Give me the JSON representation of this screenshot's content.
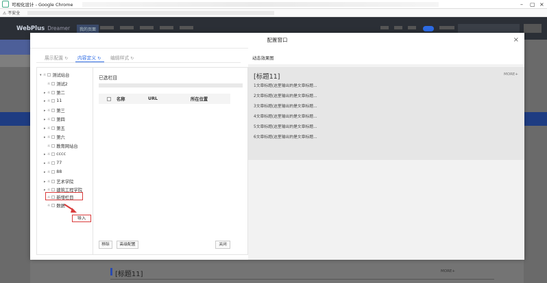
{
  "browser": {
    "title": "可视化设计 - Google Chrome",
    "security": "不安全"
  },
  "app": {
    "brand": "WebPlus",
    "brand_sub": "Dreamer",
    "nav_active": "我的页面"
  },
  "background": {
    "heading": "[标题11]",
    "more": "MORE+"
  },
  "modal": {
    "title": "配置窗口",
    "tabs": [
      {
        "label": "展示配置",
        "active": false
      },
      {
        "label": "内容定义",
        "active": true
      },
      {
        "label": "编辑样式",
        "active": false
      }
    ],
    "tree": [
      {
        "label": "测试站台",
        "level": 0,
        "expanded": true
      },
      {
        "label": "测试2",
        "level": 1,
        "leaf": true
      },
      {
        "label": "第二",
        "level": 1
      },
      {
        "label": "11",
        "level": 1
      },
      {
        "label": "第三",
        "level": 1
      },
      {
        "label": "第四",
        "level": 1
      },
      {
        "label": "第五",
        "level": 1
      },
      {
        "label": "第六",
        "level": 1
      },
      {
        "label": "教育网站台",
        "level": 1,
        "leaf": true
      },
      {
        "label": "cccc",
        "level": 1
      },
      {
        "label": "77",
        "level": 1
      },
      {
        "label": "88",
        "level": 1
      },
      {
        "label": "艺术学院",
        "level": 1
      },
      {
        "label": "建筑工程学院",
        "level": 1
      },
      {
        "label": "新增栏目",
        "level": 1,
        "leaf": true
      },
      {
        "label": "数据",
        "level": 1,
        "leaf": true
      }
    ],
    "import_label": "导入",
    "selected_title": "已选栏目",
    "columns": [
      "名称",
      "URL",
      "所在位置"
    ],
    "buttons": {
      "remove": "移除",
      "advanced": "高级配置",
      "close": "关闭"
    },
    "preview": {
      "header": "动态效果图",
      "title": "[标题11]",
      "more": "MORE+",
      "items": [
        "1文章标题(这里输出的是文章标题...",
        "2文章标题(这里输出的是文章标题...",
        "3文章标题(这里输出的是文章标题...",
        "4文章标题(这里输出的是文章标题...",
        "5文章标题(这里输出的是文章标题...",
        "6文章标题(这里输出的是文章标题..."
      ]
    }
  }
}
